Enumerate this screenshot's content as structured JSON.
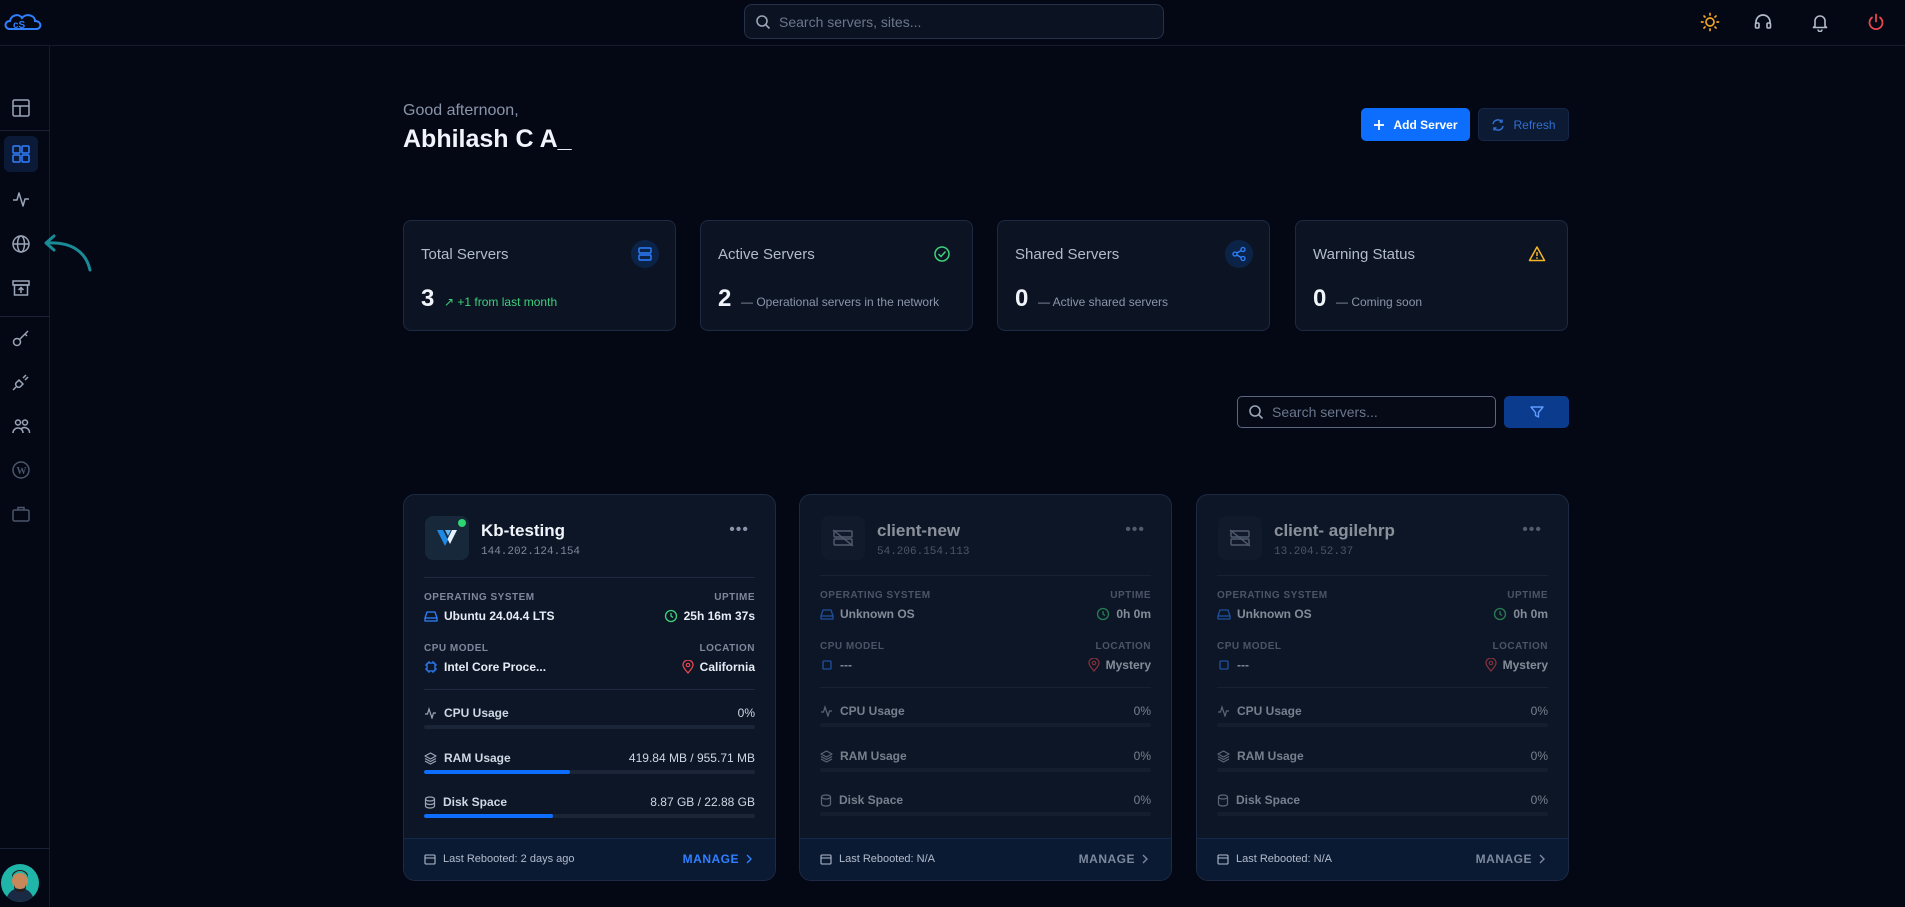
{
  "topbar": {
    "search_placeholder": "Search servers, sites...",
    "icons": [
      "theme-sun-icon",
      "support-headset-icon",
      "notification-bell-icon",
      "power-icon"
    ]
  },
  "sidebar": {
    "items": [
      "dashboard-icon",
      "servers-grid-icon",
      "activity-icon",
      "sites-globe-icon",
      "deploy-icon",
      "keys-icon",
      "integrations-plug-icon",
      "team-icon",
      "wordpress-icon",
      "briefcase-icon"
    ],
    "active_index": 1
  },
  "header": {
    "greeting": "Good afternoon,",
    "username": "Abhilash C A_",
    "add_server_label": "Add Server",
    "refresh_label": "Refresh"
  },
  "stats": [
    {
      "label": "Total Servers",
      "value": "3",
      "sub": "+1 from last month",
      "icon": "server-icon",
      "accent": "#2f80ff"
    },
    {
      "label": "Active Servers",
      "value": "2",
      "sub": "— Operational servers in the network",
      "icon": "check-circle-icon",
      "accent": "#3fd07a"
    },
    {
      "label": "Shared Servers",
      "value": "0",
      "sub": "— Active shared servers",
      "icon": "share-icon",
      "accent": "#2f80ff"
    },
    {
      "label": "Warning Status",
      "value": "0",
      "sub": "— Coming soon",
      "icon": "warning-icon",
      "accent": "#f5b524"
    }
  ],
  "server_search": {
    "placeholder": "Search servers..."
  },
  "labels": {
    "os": "OPERATING SYSTEM",
    "uptime": "UPTIME",
    "cpu_model": "CPU MODEL",
    "location": "LOCATION",
    "cpu_usage": "CPU Usage",
    "ram_usage": "RAM Usage",
    "disk_space": "Disk Space",
    "manage": "MANAGE"
  },
  "servers": [
    {
      "name": "Kb-testing",
      "ip": "144.202.124.154",
      "online": true,
      "os": "Ubuntu 24.04.4 LTS",
      "uptime": "25h 16m 37s",
      "cpu_model": "Intel Core Proce...",
      "location": "California",
      "cpu_usage": "0%",
      "cpu_fraction": 0.0,
      "ram_usage": "419.84 MB / 955.71 MB",
      "ram_fraction": 0.44,
      "disk_space": "8.87 GB / 22.88 GB",
      "disk_fraction": 0.39,
      "last_rebooted": "Last Rebooted: 2 days ago"
    },
    {
      "name": "client-new",
      "ip": "54.206.154.113",
      "online": false,
      "os": "Unknown OS",
      "uptime": "0h 0m",
      "cpu_model": "---",
      "location": "Mystery",
      "cpu_usage": "0%",
      "cpu_fraction": 0.0,
      "ram_usage": "0%",
      "ram_fraction": 0.0,
      "disk_space": "0%",
      "disk_fraction": 0.0,
      "last_rebooted": "Last Rebooted: N/A"
    },
    {
      "name": "client- agilehrp",
      "ip": "13.204.52.37",
      "online": false,
      "os": "Unknown OS",
      "uptime": "0h 0m",
      "cpu_model": "---",
      "location": "Mystery",
      "cpu_usage": "0%",
      "cpu_fraction": 0.0,
      "ram_usage": "0%",
      "ram_fraction": 0.0,
      "disk_space": "0%",
      "disk_fraction": 0.0,
      "last_rebooted": "Last Rebooted: N/A"
    }
  ]
}
